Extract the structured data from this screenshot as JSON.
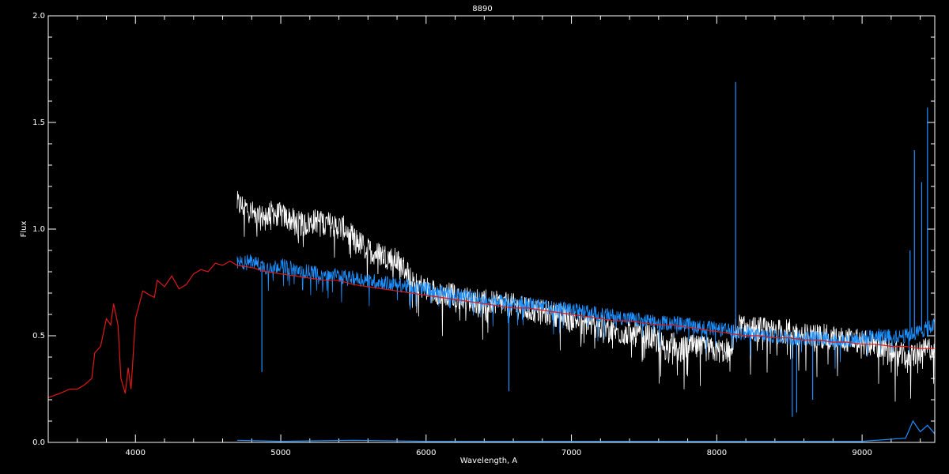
{
  "chart_data": {
    "type": "line",
    "title": "8890",
    "xlabel": "Wavelength, A",
    "ylabel": "Flux",
    "xlim": [
      3400,
      9500
    ],
    "ylim": [
      0.0,
      2.0
    ],
    "x_ticks": [
      4000,
      5000,
      6000,
      7000,
      8000,
      9000
    ],
    "x_tick_labels": [
      "4000",
      "5000",
      "6000",
      "7000",
      "8000",
      "9000"
    ],
    "y_ticks": [
      0.0,
      0.5,
      1.0,
      1.5,
      2.0
    ],
    "y_tick_labels": [
      "0.0",
      "0.5",
      "1.0",
      "1.5",
      "2.0"
    ],
    "grid": false,
    "colors": {
      "background": "#000000",
      "axes": "#ffffff",
      "white_spectrum": "#ffffff",
      "blue_spectrum": "#1e90ff",
      "red_model": "#e01818"
    },
    "series": [
      {
        "color": "#ffffff",
        "noise": 0.06,
        "x": [
          4700,
          4760,
          4850,
          4950,
          5050,
          5150,
          5250,
          5350,
          5450,
          5500,
          5550,
          5600,
          5700,
          5800,
          5900,
          5950,
          6000,
          6100,
          6200,
          6300,
          6400,
          6500,
          6600,
          6700,
          6800,
          6900,
          7000,
          7100,
          7200,
          7300,
          7400,
          7500,
          7600,
          7650,
          7700,
          7750,
          7800,
          7900,
          8000,
          8100,
          8120,
          8140,
          8200,
          8300,
          8400,
          8500,
          8600,
          8700,
          8800,
          8900,
          9000,
          9100,
          9200,
          9300,
          9400,
          9500
        ],
        "y": [
          1.12,
          1.1,
          1.05,
          1.08,
          1.05,
          1.02,
          1.04,
          1.02,
          1.0,
          0.96,
          0.93,
          0.9,
          0.88,
          0.85,
          0.78,
          0.74,
          0.72,
          0.7,
          0.69,
          0.67,
          0.66,
          0.65,
          0.64,
          0.62,
          0.61,
          0.6,
          0.58,
          0.56,
          0.54,
          0.52,
          0.51,
          0.5,
          0.48,
          0.44,
          0.46,
          0.43,
          0.45,
          0.44,
          0.43,
          0.43,
          0.52,
          0.55,
          0.53,
          0.53,
          0.52,
          0.52,
          0.5,
          0.5,
          0.49,
          0.48,
          0.47,
          0.45,
          0.43,
          0.4,
          0.42,
          0.45
        ]
      },
      {
        "color": "#1e90ff",
        "noise": 0.035,
        "x": [
          4700,
          4800,
          4900,
          5000,
          5100,
          5200,
          5300,
          5400,
          5500,
          5600,
          5700,
          5800,
          5900,
          6000,
          6100,
          6200,
          6300,
          6400,
          6500,
          6600,
          6700,
          6800,
          6900,
          7000,
          7100,
          7200,
          7300,
          7400,
          7500,
          7600,
          7700,
          7800,
          7900,
          8000,
          8100,
          8200,
          8300,
          8400,
          8500,
          8600,
          8700,
          8800,
          8900,
          9000,
          9100,
          9200,
          9300,
          9400,
          9500
        ],
        "y": [
          0.84,
          0.85,
          0.82,
          0.83,
          0.81,
          0.8,
          0.79,
          0.78,
          0.77,
          0.76,
          0.75,
          0.74,
          0.73,
          0.72,
          0.7,
          0.69,
          0.68,
          0.67,
          0.66,
          0.65,
          0.65,
          0.64,
          0.63,
          0.62,
          0.61,
          0.6,
          0.59,
          0.58,
          0.57,
          0.56,
          0.56,
          0.55,
          0.54,
          0.53,
          0.52,
          0.51,
          0.5,
          0.5,
          0.49,
          0.49,
          0.49,
          0.48,
          0.48,
          0.49,
          0.5,
          0.5,
          0.5,
          0.52,
          0.55
        ]
      },
      {
        "color": "#1e90ff",
        "spikes": true,
        "x": [
          4870,
          6570,
          8130,
          8520,
          8550,
          8660,
          9330,
          9360,
          9410,
          9450
        ],
        "y": [
          0.33,
          0.24,
          1.69,
          0.12,
          0.14,
          0.2,
          0.9,
          1.37,
          1.22,
          1.57
        ]
      },
      {
        "color": "#1e90ff",
        "x": [
          4700,
          5000,
          5500,
          6000,
          6500,
          7000,
          7500,
          8000,
          8500,
          9000,
          9300,
          9350,
          9400,
          9450,
          9500
        ],
        "y": [
          0.01,
          0.005,
          0.01,
          0.005,
          0.005,
          0.005,
          0.005,
          0.005,
          0.005,
          0.005,
          0.02,
          0.1,
          0.05,
          0.08,
          0.04
        ]
      },
      {
        "color": "#e01818",
        "x": [
          3400,
          3480,
          3550,
          3600,
          3650,
          3700,
          3720,
          3760,
          3800,
          3830,
          3850,
          3880,
          3900,
          3930,
          3950,
          3970,
          4000,
          4050,
          4100,
          4130,
          4150,
          4200,
          4250,
          4300,
          4350,
          4400,
          4450,
          4500,
          4550,
          4600,
          4650,
          4700,
          4800,
          4900,
          5000,
          5100,
          5200,
          5300,
          5400,
          5500,
          5600,
          5700,
          5800,
          5900,
          6000,
          6100,
          6200,
          6300,
          6400,
          6500,
          6600,
          6700,
          6800,
          6900,
          7000,
          7100,
          7200,
          7300,
          7400,
          7500,
          7600,
          7700,
          7800,
          7900,
          8000,
          8100,
          8200,
          8300,
          8400,
          8500,
          8600,
          8700,
          8800,
          8900,
          9000,
          9100,
          9200,
          9300,
          9400,
          9500
        ],
        "y": [
          0.21,
          0.23,
          0.25,
          0.25,
          0.27,
          0.3,
          0.42,
          0.45,
          0.58,
          0.55,
          0.65,
          0.55,
          0.3,
          0.23,
          0.35,
          0.25,
          0.58,
          0.71,
          0.69,
          0.68,
          0.76,
          0.73,
          0.78,
          0.72,
          0.74,
          0.79,
          0.81,
          0.8,
          0.84,
          0.83,
          0.85,
          0.83,
          0.82,
          0.8,
          0.79,
          0.78,
          0.77,
          0.76,
          0.76,
          0.74,
          0.73,
          0.72,
          0.71,
          0.7,
          0.69,
          0.68,
          0.67,
          0.66,
          0.65,
          0.64,
          0.63,
          0.63,
          0.62,
          0.61,
          0.6,
          0.59,
          0.58,
          0.57,
          0.57,
          0.56,
          0.55,
          0.55,
          0.54,
          0.53,
          0.52,
          0.51,
          0.5,
          0.5,
          0.49,
          0.49,
          0.48,
          0.48,
          0.47,
          0.47,
          0.46,
          0.46,
          0.45,
          0.45,
          0.44,
          0.44
        ]
      }
    ]
  }
}
